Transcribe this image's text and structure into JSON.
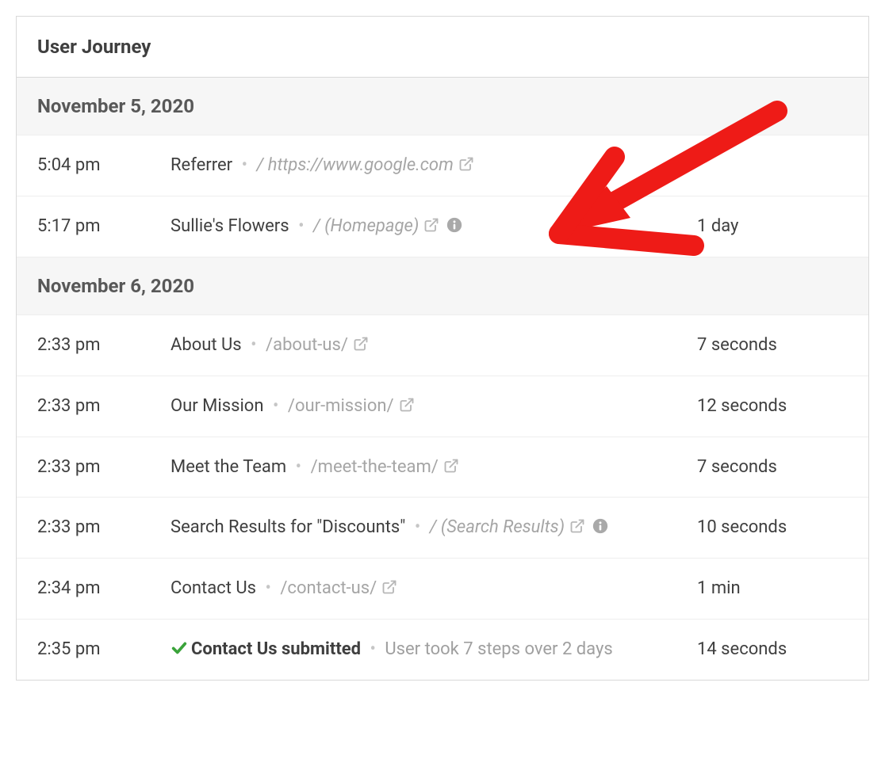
{
  "panel_title": "User Journey",
  "groups": [
    {
      "date": "November 5, 2020",
      "rows": [
        {
          "time": "5:04 pm",
          "title": "Referrer",
          "path_prefix": "/ ",
          "path": "https://www.google.com",
          "path_italic": true,
          "duration": "",
          "external": true,
          "info": false,
          "submitted": false
        },
        {
          "time": "5:17 pm",
          "title": "Sullie's Flowers",
          "path_prefix": "/ ",
          "path": "(Homepage)",
          "path_italic": true,
          "duration": "1 day",
          "external": true,
          "info": true,
          "submitted": false
        }
      ]
    },
    {
      "date": "November 6, 2020",
      "rows": [
        {
          "time": "2:33 pm",
          "title": "About Us",
          "path_prefix": "",
          "path": "/about-us/",
          "path_italic": false,
          "duration": "7 seconds",
          "external": true,
          "info": false,
          "submitted": false
        },
        {
          "time": "2:33 pm",
          "title": "Our Mission",
          "path_prefix": "",
          "path": "/our-mission/",
          "path_italic": false,
          "duration": "12 seconds",
          "external": true,
          "info": false,
          "submitted": false
        },
        {
          "time": "2:33 pm",
          "title": "Meet the Team",
          "path_prefix": "",
          "path": "/meet-the-team/",
          "path_italic": false,
          "duration": "7 seconds",
          "external": true,
          "info": false,
          "submitted": false
        },
        {
          "time": "2:33 pm",
          "title": "Search Results for \"Discounts\"",
          "path_prefix": "/ ",
          "path": "(Search Results)",
          "path_italic": true,
          "duration": "10 seconds",
          "external": true,
          "info": true,
          "submitted": false
        },
        {
          "time": "2:34 pm",
          "title": "Contact Us",
          "path_prefix": "",
          "path": "/contact-us/",
          "path_italic": false,
          "duration": "1 min",
          "external": true,
          "info": false,
          "submitted": false
        },
        {
          "time": "2:35 pm",
          "title": "Contact Us submitted",
          "path_prefix": "",
          "path": "",
          "summary": "User took 7 steps over 2 days",
          "duration": "14 seconds",
          "external": false,
          "info": false,
          "submitted": true
        }
      ]
    }
  ]
}
